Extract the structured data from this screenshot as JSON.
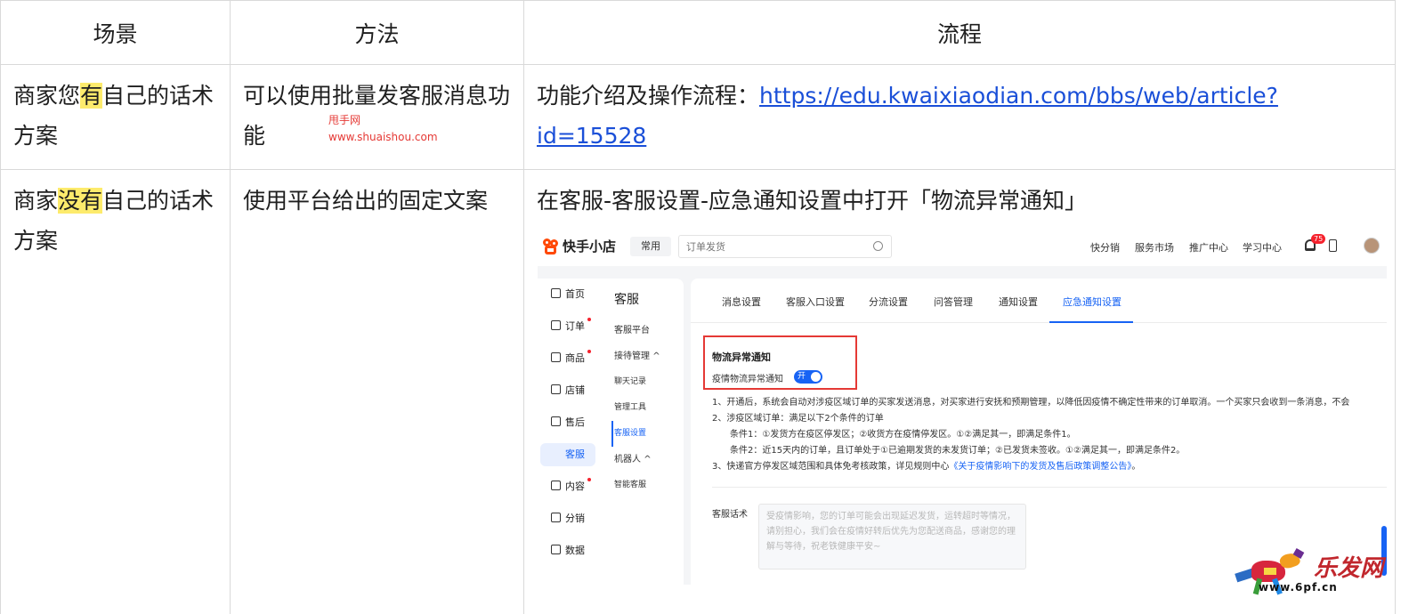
{
  "table": {
    "headers": [
      "场景",
      "方法",
      "流程"
    ],
    "row1": {
      "scene_pre": "商家您",
      "scene_hl": "有",
      "scene_post": "自己的话术方案",
      "method": "可以使用批量发客服消息功能",
      "flow_prefix": "功能介绍及操作流程：",
      "flow_link": "https://edu.kwaixiaodian.com/bbs/web/article?id=15528"
    },
    "row2": {
      "scene_pre": "商家",
      "scene_hl": "没有",
      "scene_post": "自己的话术方案",
      "method": "使用平台给出的固定文案",
      "flow_text": "在客服-客服设置-应急通知设置中打开「物流异常通知」"
    }
  },
  "watermark": {
    "line1": "甩手网",
    "line2": "www.shuaishou.com"
  },
  "screenshot": {
    "logo": "快手小店",
    "chip": "常用",
    "search_placeholder": "订单发货",
    "nav": [
      "快分销",
      "服务市场",
      "推广中心",
      "学习中心"
    ],
    "badge": "75",
    "menu": [
      {
        "label": "首页",
        "icon": "home-icon"
      },
      {
        "label": "订单",
        "icon": "order-icon",
        "dot": true
      },
      {
        "label": "商品",
        "icon": "goods-icon",
        "dot": true
      },
      {
        "label": "店铺",
        "icon": "shop-icon"
      },
      {
        "label": "售后",
        "icon": "aftersale-icon"
      },
      {
        "label": "客服",
        "icon": "service-icon",
        "active": true
      },
      {
        "label": "内容",
        "icon": "content-icon",
        "dot": true
      },
      {
        "label": "分销",
        "icon": "distribution-icon"
      },
      {
        "label": "数据",
        "icon": "data-icon"
      }
    ],
    "sub": {
      "title": "客服",
      "items": [
        "客服平台",
        "接待管理",
        "聊天记录",
        "管理工具",
        "客服设置",
        "机器人",
        "智能客服"
      ]
    },
    "tabs": [
      "消息设置",
      "客服入口设置",
      "分流设置",
      "问答管理",
      "通知设置",
      "应急通知设置"
    ],
    "notice_title": "物流异常通知",
    "notice_label": "疫情物流异常通知",
    "toggle_text": "开",
    "rules": [
      "1、开通后，系统会自动对涉疫区域订单的买家发送消息，对买家进行安抚和预期管理，以降低因疫情不确定性带来的订单取消。一个买家只会收到一条消息，不会",
      "2、涉疫区域订单：满足以下2个条件的订单",
      "条件1：①发货方在疫区停发区；②收货方在疫情停发区。①②满足其一，即满足条件1。",
      "条件2：近15天内的订单，且订单处于①已逾期发货的未发货订单；②已发货未签收。①②满足其一，即满足条件2。",
      "3、快递官方停发区域范围和具体免考核政策，详见规则中心"
    ],
    "rule_link": "《关于疫情影响下的发货及售后政策调整公告》",
    "rule_end": "。",
    "kf_label": "客服话术",
    "kf_text": "受疫情影响，您的订单可能会出现延迟发货，运转超时等情况，请别担心，我们会在疫情好转后优先为您配送商品，感谢您的理解与等待，祝老铁健康平安~"
  },
  "brand": {
    "name": "乐发网",
    "url": "www.6pf.cn"
  },
  "colors": {
    "highlight": "#fdeb6c",
    "link": "#1a4fd8",
    "accent": "#1763f4",
    "red": "#e53935"
  }
}
